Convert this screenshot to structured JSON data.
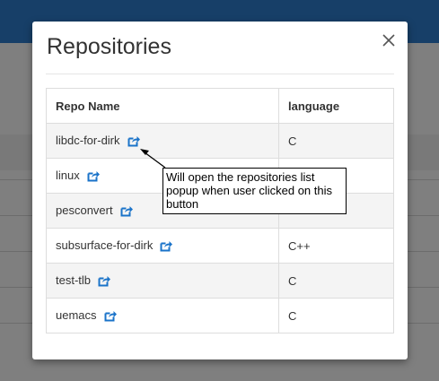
{
  "modal": {
    "title": "Repositories",
    "close_icon": "close-icon"
  },
  "table": {
    "headers": [
      "Repo Name",
      "language"
    ],
    "rows": [
      {
        "name": "libdc-for-dirk",
        "language": "C",
        "icon": "external-link-icon"
      },
      {
        "name": "linux",
        "language": "",
        "icon": "external-link-icon"
      },
      {
        "name": "pesconvert",
        "language": "",
        "icon": "external-link-icon"
      },
      {
        "name": "subsurface-for-dirk",
        "language": "C++",
        "icon": "external-link-icon"
      },
      {
        "name": "test-tlb",
        "language": "C",
        "icon": "external-link-icon"
      },
      {
        "name": "uemacs",
        "language": "C",
        "icon": "external-link-icon"
      }
    ]
  },
  "annotation": {
    "text": "Will open the repositories list popup when user clicked on this button"
  },
  "colors": {
    "accent_blue": "#2f7fd0",
    "icon_blue": "#1a73c9",
    "overlay": "rgba(0,0,0,0.5)"
  }
}
